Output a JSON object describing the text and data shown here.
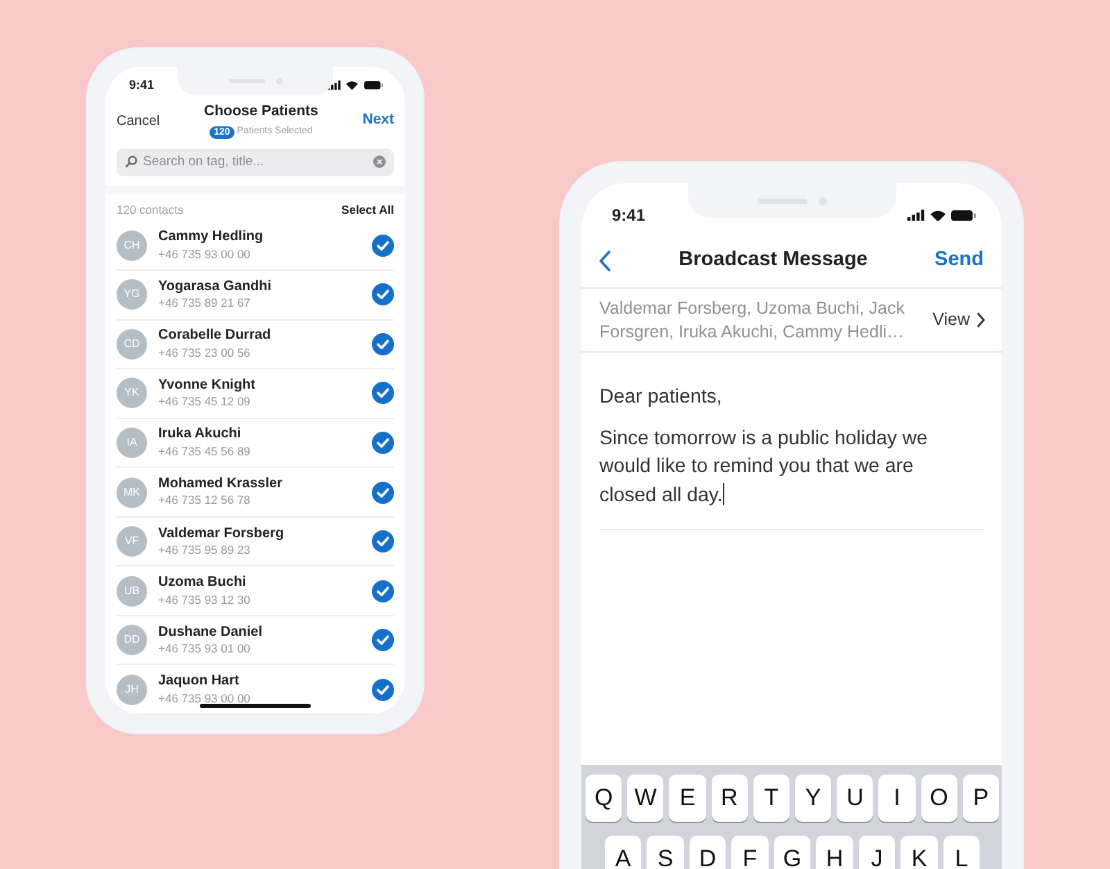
{
  "left_phone": {
    "status_time": "9:41",
    "header": {
      "cancel": "Cancel",
      "title": "Choose Patients",
      "selected_count": "120",
      "selected_label": "Patients Selected",
      "next": "Next"
    },
    "search": {
      "placeholder": "Search on tag, title..."
    },
    "contacts_count": "120 contacts",
    "select_all": "Select All",
    "contacts": [
      {
        "initials": "CH",
        "name": "Cammy Hedling",
        "phone": "+46 735 93 00 00",
        "checked": true
      },
      {
        "initials": "YG",
        "name": "Yogarasa Gandhi",
        "phone": "+46 735 89 21 67",
        "checked": true
      },
      {
        "initials": "CD",
        "name": "Corabelle Durrad",
        "phone": "+46 735 23 00 56",
        "checked": true
      },
      {
        "initials": "YK",
        "name": "Yvonne Knight",
        "phone": "+46 735 45 12 09",
        "checked": true
      },
      {
        "initials": "IA",
        "name": "Iruka Akuchi",
        "phone": "+46 735 45 56 89",
        "checked": true
      },
      {
        "initials": "MK",
        "name": "Mohamed Krassler",
        "phone": "+46 735 12 56 78",
        "checked": true
      },
      {
        "initials": "VF",
        "name": "Valdemar Forsberg",
        "phone": "+46 735 95 89 23",
        "checked": true
      },
      {
        "initials": "UB",
        "name": "Uzoma Buchi",
        "phone": "+46 735 93 12 30",
        "checked": true
      },
      {
        "initials": "DD",
        "name": "Dushane Daniel",
        "phone": "+46 735 93 01 00",
        "checked": true
      },
      {
        "initials": "JH",
        "name": "Jaquon Hart",
        "phone": "+46 735 93 00 00",
        "checked": true
      }
    ]
  },
  "right_phone": {
    "status_time": "9:41",
    "header": {
      "title": "Broadcast Message",
      "send": "Send"
    },
    "recipients": "Valdemar Forsberg, Uzoma Buchi, Jack Forsgren, Iruka Akuchi, Cammy Hedli…",
    "view": "View",
    "message": {
      "greeting": "Dear patients,",
      "body": "Since tomorrow is a public holiday we would like to remind you that we are closed all day."
    },
    "keyboard": {
      "rows": [
        [
          "Q",
          "W",
          "E",
          "R",
          "T",
          "Y",
          "U",
          "I",
          "O",
          "P"
        ],
        [
          "A",
          "S",
          "D",
          "F",
          "G",
          "H",
          "J",
          "K",
          "L"
        ]
      ]
    }
  }
}
